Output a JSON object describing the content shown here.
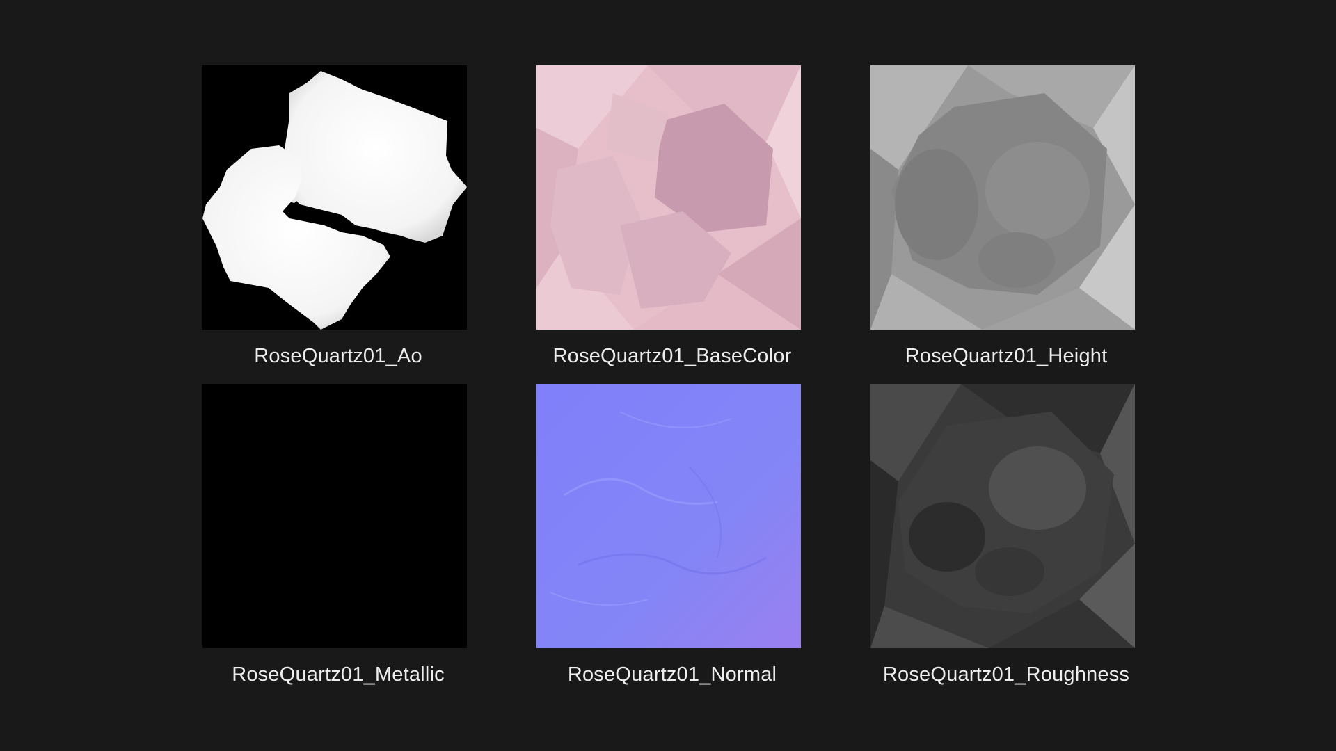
{
  "thumbnails": [
    {
      "label": "RoseQuartz01_Ao",
      "map": "ambient-occlusion",
      "dominant_color": "#000000"
    },
    {
      "label": "RoseQuartz01_BaseColor",
      "map": "base-color",
      "dominant_color": "#e8c2cc"
    },
    {
      "label": "RoseQuartz01_Height",
      "map": "height",
      "dominant_color": "#8c8c8c"
    },
    {
      "label": "RoseQuartz01_Metallic",
      "map": "metallic",
      "dominant_color": "#000000"
    },
    {
      "label": "RoseQuartz01_Normal",
      "map": "normal",
      "dominant_color": "#8282f8"
    },
    {
      "label": "RoseQuartz01_Roughness",
      "map": "roughness",
      "dominant_color": "#3a3a3a"
    }
  ],
  "background_color": "#191919",
  "text_color": "#eeeeee"
}
